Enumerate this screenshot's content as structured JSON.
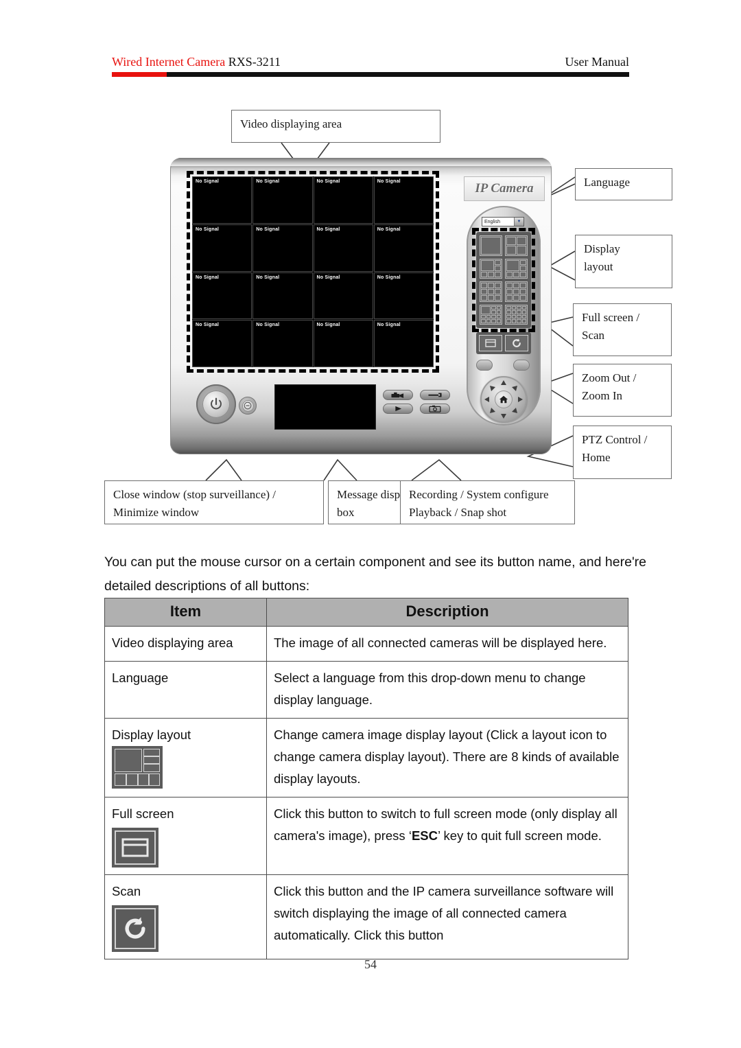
{
  "header": {
    "title_red": "Wired Internet Camera",
    "title_black": " RXS-3211",
    "right_label": "User Manual"
  },
  "figure": {
    "callouts": {
      "video_area": "Video displaying area",
      "language": "Language",
      "display_layout_line1": "Display",
      "display_layout_line2": "layout",
      "fullscreen_scan_line1": "Full screen /",
      "fullscreen_scan_line2": "Scan",
      "zoom_line1": "Zoom Out /",
      "zoom_line2": "Zoom In",
      "ptz_line1": "PTZ Control /",
      "ptz_line2": "Home",
      "close_line1": "Close window (stop surveillance) /",
      "close_line2": "Minimize window",
      "message_line1": "Message display",
      "message_line2": "box",
      "record_line1": "Recording / System configure",
      "record_line2": "Playback / Snap shot"
    },
    "app": {
      "logo": "IP Camera",
      "language_value": "English",
      "language_arrow": "▼",
      "no_signal": "No Signal",
      "video_cells": [
        "No Signal",
        "No Signal",
        "No Signal",
        "No Signal",
        "No Signal",
        "No Signal",
        "No Signal",
        "No Signal",
        "No Signal",
        "No Signal",
        "No Signal",
        "No Signal",
        "No Signal",
        "No Signal",
        "No Signal",
        "No Signal"
      ],
      "power_icon": "⏻",
      "minimize_icon": "⊖",
      "home_icon": "⌂",
      "btn_recording_icon": "⬬",
      "btn_sysconfig_icon": "⚊",
      "btn_playback_icon": "▶",
      "btn_snapshot_icon": "⬜"
    }
  },
  "body": {
    "paragraph": "You can put the mouse cursor on a certain component and see its button name, and here're detailed descriptions of all buttons:"
  },
  "table": {
    "headers": {
      "item": "Item",
      "description": "Description"
    },
    "rows": [
      {
        "item": "Video displaying area",
        "icon": "none",
        "description": "The image of all connected cameras will be displayed here."
      },
      {
        "item": "Language",
        "icon": "none",
        "description": "Select a language from this drop-down menu to change display language."
      },
      {
        "item": "Display layout",
        "icon": "layout",
        "description": "Change camera image display layout (Click a layout icon to change camera display layout). There are 8 kinds of available display layouts."
      },
      {
        "item": "Full screen",
        "icon": "fullscreen",
        "description_pre": "Click this button to switch to full screen mode (only display all camera's image), press ‘",
        "description_bold": "ESC",
        "description_post": "’ key to quit full screen mode."
      },
      {
        "item": "Scan",
        "icon": "scan",
        "description": "Click this button and the IP camera surveillance software will switch displaying the image of all connected camera automatically. Click this button"
      }
    ]
  },
  "footer": {
    "page_number": "54"
  },
  "colors": {
    "brand_red": "#e8120e",
    "rule_black": "#111111",
    "table_header_gray": "#b0b0b0"
  }
}
